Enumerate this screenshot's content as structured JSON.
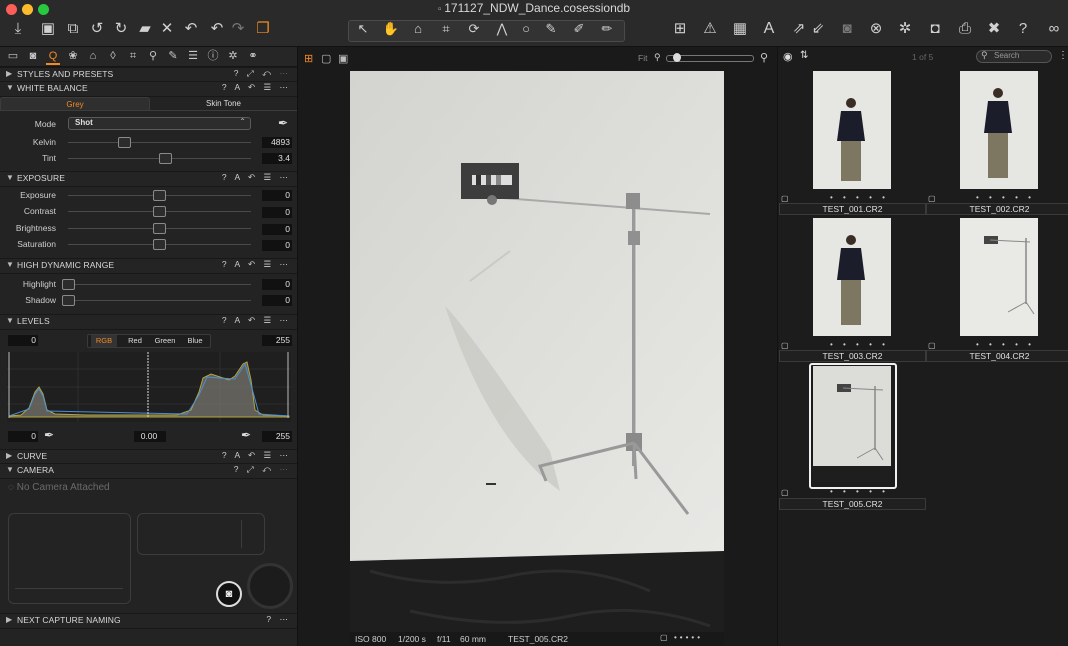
{
  "window": {
    "title": "171127_NDW_Dance.cosessiondb"
  },
  "toolbar": {
    "left_icons": [
      "import-icon",
      "capture-icon",
      "export-icon",
      "rotate-left-icon",
      "rotate-right-icon",
      "move-icon",
      "delete-icon",
      "undo-icon",
      "undo2-icon",
      "redo-icon",
      "stack-icon"
    ],
    "cursor_tools": [
      "select-icon",
      "pan-icon",
      "loupe-icon",
      "crop-icon",
      "rotate-icon",
      "keystone-icon",
      "spot-icon",
      "brush-icon",
      "eraser-icon",
      "picker-icon"
    ],
    "right_icons": [
      "grid-icon",
      "warning-icon",
      "proof-icon",
      "text-icon",
      "adjust-copy-icon",
      "camera-icon",
      "reset-icon",
      "settings-icon",
      "preview-icon",
      "print-icon",
      "tools-icon",
      "help-icon",
      "glasses-icon"
    ]
  },
  "left": {
    "tool_tabs": [
      "folder-icon",
      "camera-tab-icon",
      "exposure-tab-icon",
      "color-tab-icon",
      "lens-tab-icon",
      "detail-tab-icon",
      "crop-tab-icon",
      "search-tab-icon",
      "brush-tab-icon",
      "metadata-tab-icon",
      "info-tab-icon",
      "settings-tab-icon",
      "batch-tab-icon"
    ],
    "styles": {
      "title": "STYLES AND PRESETS",
      "controls": "? ⤢ ↶ ⋯"
    },
    "wb": {
      "title": "WHITE BALANCE",
      "controls": "? A ↶ ☰ ⋯",
      "tab_grey": "Grey",
      "tab_skin": "Skin Tone",
      "mode_label": "Mode",
      "mode_value": "Shot",
      "kelvin_label": "Kelvin",
      "kelvin_value": "4893",
      "tint_label": "Tint",
      "tint_value": "3.4"
    },
    "exposure": {
      "title": "EXPOSURE",
      "controls": "? A ↶ ☰ ⋯",
      "rows": [
        {
          "label": "Exposure",
          "value": "0"
        },
        {
          "label": "Contrast",
          "value": "0"
        },
        {
          "label": "Brightness",
          "value": "0"
        },
        {
          "label": "Saturation",
          "value": "0"
        }
      ]
    },
    "hdr": {
      "title": "HIGH DYNAMIC RANGE",
      "controls": "? A ↶ ☰ ⋯",
      "rows": [
        {
          "label": "Highlight",
          "value": "0"
        },
        {
          "label": "Shadow",
          "value": "0"
        }
      ]
    },
    "levels": {
      "title": "LEVELS",
      "controls": "? A ↶ ☰ ⋯",
      "in_low": "0",
      "in_high": "255",
      "channels": [
        "RGB",
        "Red",
        "Green",
        "Blue"
      ],
      "out_low": "0",
      "mid": "0.00",
      "out_high": "255"
    },
    "curve": {
      "title": "CURVE",
      "controls": "? A ↶ ☰ ⋯"
    },
    "camera": {
      "title": "CAMERA",
      "controls": "? ⤢ ↶ ⋯",
      "status": "No Camera Attached"
    },
    "naming": {
      "title": "NEXT CAPTURE NAMING",
      "controls": "? ⋯"
    }
  },
  "viewer": {
    "fit_label": "Fit",
    "status": {
      "iso": "ISO 800",
      "shutter": "1/200 s",
      "aperture": "f/11",
      "focal": "60 mm",
      "filename": "TEST_005.CR2"
    }
  },
  "browser": {
    "count": "1 of 5",
    "search_placeholder": "Search",
    "items": [
      {
        "name": "TEST_001.CR2",
        "rating": "• • • • •"
      },
      {
        "name": "TEST_002.CR2",
        "rating": "• • • • •"
      },
      {
        "name": "TEST_003.CR2",
        "rating": "• • • • •"
      },
      {
        "name": "TEST_004.CR2",
        "rating": "• • • • •"
      },
      {
        "name": "TEST_005.CR2",
        "rating": "• • • • •"
      }
    ]
  },
  "colors": {
    "accent": "#f08a24",
    "panel": "#232323",
    "background": "#1b1b1b"
  }
}
